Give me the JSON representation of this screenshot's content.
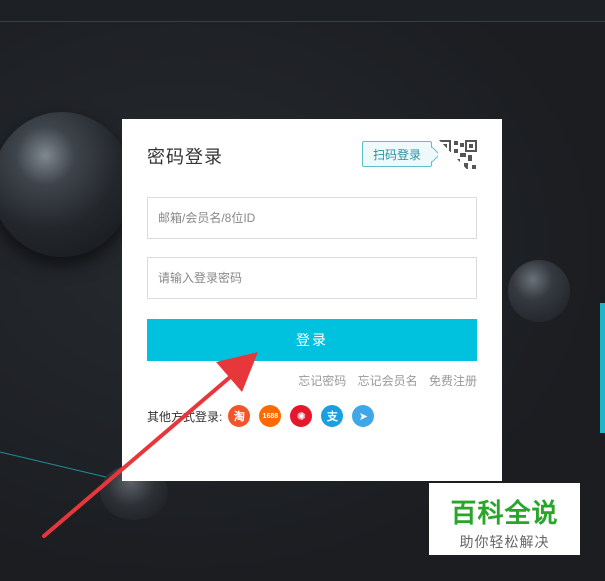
{
  "login": {
    "title": "密码登录",
    "qr_tip": "扫码登录",
    "account_placeholder": "邮箱/会员名/8位ID",
    "password_placeholder": "请输入登录密码",
    "submit_label": "登录",
    "forgot_password": "忘记密码",
    "forgot_username": "忘记会员名",
    "register": "免费注册",
    "other_label": "其他方式登录:",
    "social": [
      {
        "name": "taobao",
        "glyph": "淘"
      },
      {
        "name": "1688",
        "glyph": "1688"
      },
      {
        "name": "weibo",
        "glyph": "✺"
      },
      {
        "name": "alipay",
        "glyph": "支"
      },
      {
        "name": "aliwangwang",
        "glyph": "➤"
      }
    ]
  },
  "watermark": {
    "main": "百科全说",
    "sub": "助你轻松解决"
  },
  "colors": {
    "accent": "#00c1de",
    "annotation_arrow": "#e8373a",
    "background": "#1d2024"
  }
}
